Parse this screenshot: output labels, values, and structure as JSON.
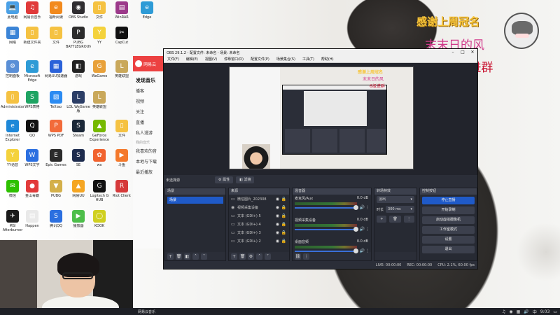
{
  "desktop": {
    "icons": [
      {
        "label": "此电脑",
        "color": "#4aa0e6",
        "glyph": "💻",
        "name": "this-pc-icon"
      },
      {
        "label": "网易云音乐",
        "color": "#e03a3a",
        "glyph": "♫",
        "name": "netease-music-icon"
      },
      {
        "label": "福昕阅读",
        "color": "#f28a1d",
        "glyph": "e",
        "name": "reader-icon"
      },
      {
        "label": "OBS Studio",
        "color": "#302e31",
        "glyph": "◉",
        "name": "obs-studio-icon"
      },
      {
        "label": "文件",
        "color": "#f5c242",
        "glyph": "▯",
        "name": "folder-icon"
      },
      {
        "label": "WinRAR",
        "color": "#9c3a8a",
        "glyph": "▤",
        "name": "winrar-icon"
      },
      {
        "label": "Edge",
        "color": "#2e9bd6",
        "glyph": "e",
        "name": "edge-browser-icon"
      },
      {
        "label": "网络",
        "color": "#3b84d6",
        "glyph": "▦",
        "name": "network-icon"
      },
      {
        "label": "新建文件夹",
        "color": "#f5c242",
        "glyph": "▯",
        "name": "folder-icon"
      },
      {
        "label": "文件",
        "color": "#f5c242",
        "glyph": "▯",
        "name": "folder-icon"
      },
      {
        "label": "PUBG BATTLEGROUNDS",
        "color": "#2c2c2c",
        "glyph": "P",
        "name": "pubg-icon"
      },
      {
        "label": "YY",
        "color": "#f4d23c",
        "glyph": "Y",
        "name": "yy-icon"
      },
      {
        "label": "CapCut",
        "color": "#111111",
        "glyph": "✂",
        "name": "capcut-icon"
      },
      {
        "label": "控制面板",
        "color": "#5a8fd6",
        "glyph": "⚙",
        "name": "control-panel-icon"
      },
      {
        "label": "Microsoft Edge",
        "color": "#2e9bd6",
        "glyph": "e",
        "name": "edge-icon"
      },
      {
        "label": "网易UU加速器",
        "color": "#2b62d9",
        "glyph": "▦",
        "name": "uu-booster-icon"
      },
      {
        "label": "游戏",
        "color": "#222222",
        "glyph": "◧",
        "name": "game-icon"
      },
      {
        "label": "WeGame",
        "color": "#e8a13a",
        "glyph": "G",
        "name": "wegame-icon"
      },
      {
        "label": "英雄联盟",
        "color": "#c9a85a",
        "glyph": "L",
        "name": "league-icon"
      },
      {
        "label": "Administrator",
        "color": "#f5c242",
        "glyph": "▯",
        "name": "user-folder-icon"
      },
      {
        "label": "WPS表格",
        "color": "#1fa463",
        "glyph": "S",
        "name": "wps-sheet-icon"
      },
      {
        "label": "TeXiao",
        "color": "#2b8bf2",
        "glyph": "▧",
        "name": "texiao-icon"
      },
      {
        "label": "LOL WeGame版",
        "color": "#2c3e66",
        "glyph": "L",
        "name": "lol-wegame-icon"
      },
      {
        "label": "英雄联盟",
        "color": "#c9a85a",
        "glyph": "L",
        "name": "lol-icon"
      },
      {
        "label": "Internet Explorer",
        "color": "#1e88d8",
        "glyph": "e",
        "name": "ie-icon"
      },
      {
        "label": "QQ",
        "color": "#111111",
        "glyph": "Q",
        "name": "qq-icon"
      },
      {
        "label": "WPS PDF",
        "color": "#f26b3a",
        "glyph": "P",
        "name": "wps-pdf-icon"
      },
      {
        "label": "Steam",
        "color": "#1b2838",
        "glyph": "S",
        "name": "steam-icon"
      },
      {
        "label": "GeForce Experience",
        "color": "#76b900",
        "glyph": "▲",
        "name": "geforce-icon"
      },
      {
        "label": "文件",
        "color": "#f5c242",
        "glyph": "▯",
        "name": "folder-icon"
      },
      {
        "label": "YY语音",
        "color": "#f4d23c",
        "glyph": "Y",
        "name": "yy-voice-icon"
      },
      {
        "label": "WPS文字",
        "color": "#2b6fe0",
        "glyph": "W",
        "name": "wps-writer-icon"
      },
      {
        "label": "Epic Games",
        "color": "#2b2b2b",
        "glyph": "E",
        "name": "epic-icon"
      },
      {
        "label": "SE",
        "color": "#1d2b4d",
        "glyph": "S",
        "name": "se-icon"
      },
      {
        "label": "wx",
        "color": "#f1622e",
        "glyph": "✿",
        "name": "wx-icon"
      },
      {
        "label": "斗鱼",
        "color": "#f4792b",
        "glyph": "▶",
        "name": "douyu-icon"
      },
      {
        "label": "微信",
        "color": "#2dc100",
        "glyph": "✉",
        "name": "wechat-icon"
      },
      {
        "label": "金山毒霸",
        "color": "#e23b3b",
        "glyph": "●",
        "name": "antivirus-icon"
      },
      {
        "label": "PUBG",
        "color": "#d4b04a",
        "glyph": "▼",
        "name": "pubg-lite-icon"
      },
      {
        "label": "网易UU",
        "color": "#f5a623",
        "glyph": "▲",
        "name": "uu-icon"
      },
      {
        "label": "Logitech G HUB",
        "color": "#111111",
        "glyph": "G",
        "name": "logitech-icon"
      },
      {
        "label": "Riot Client",
        "color": "#d63a3a",
        "glyph": "R",
        "name": "riot-icon"
      },
      {
        "label": "MSI Afterburner",
        "color": "#1a1a1a",
        "glyph": "✈",
        "name": "afterburner-icon"
      },
      {
        "label": "Happen",
        "color": "#e9e9e9",
        "glyph": "▤",
        "name": "document-icon"
      },
      {
        "label": "腾讯QQ",
        "color": "#2b6fe0",
        "glyph": "S",
        "name": "tencent-icon"
      },
      {
        "label": "播放器",
        "color": "#4dbe4a",
        "glyph": "▶",
        "name": "player-icon"
      },
      {
        "label": "KOOK",
        "color": "#d0d020",
        "glyph": "◯",
        "name": "kook-icon"
      }
    ]
  },
  "overlay": {
    "title": "感谢上周冠名",
    "name": "末末日的风",
    "group": "6级进群"
  },
  "music_window": {
    "app_name": "网易云",
    "nav": [
      "发现音乐",
      "播客",
      "视频",
      "关注",
      "直播",
      "私人漫游"
    ],
    "section": "我的音乐",
    "sub": [
      "我喜欢的音",
      "本地与下载",
      "最近播放"
    ]
  },
  "obs": {
    "title": "OBS 29.1.2 - 配置文件: 未命名 - 场景: 未命名",
    "menu": [
      "文件(F)",
      "编辑(E)",
      "视图(V)",
      "停靠窗口(D)",
      "配置文件(P)",
      "场景集合(S)",
      "工具(T)",
      "帮助(H)"
    ],
    "source_bar": {
      "label": "未选择源",
      "settings": "属性",
      "filters": "滤镜"
    },
    "docks": {
      "scenes": "场景",
      "sources": "来源",
      "mixer": "混音器",
      "transitions": "转场特效",
      "controls": "控制按钮"
    },
    "scene_items": [
      "场景"
    ],
    "source_items": [
      {
        "label": "微信图片_202308",
        "icon": "▭"
      },
      {
        "label": "视频采集设备",
        "icon": "◉"
      },
      {
        "label": "文本 (GDI+) 5",
        "icon": "▭"
      },
      {
        "label": "文本 (GDI+) 4",
        "icon": "▭"
      },
      {
        "label": "文本 (GDI+) 3",
        "icon": "▭"
      },
      {
        "label": "文本 (GDI+) 2",
        "icon": "▭"
      }
    ],
    "mixer_channels": [
      {
        "label": "麦克风/Aux",
        "db": "0.0 dB"
      },
      {
        "label": "视频采集设备",
        "db": "0.0 dB"
      },
      {
        "label": "桌面音频",
        "db": "0.0 dB"
      }
    ],
    "transitions": {
      "type": "淡出",
      "duration_label": "时长",
      "duration": "300 ms"
    },
    "controls": [
      "停止直播",
      "开始录制",
      "启动虚拟摄像机",
      "工作室模式",
      "设置",
      "退出"
    ],
    "status": {
      "live": "LIVE: 00:00:00",
      "rec": "REC: 00:00:00",
      "cpu": "CPU: 2.1%, 60.00 fps"
    }
  },
  "taskbar": {
    "app": "网易云音乐",
    "time": "9:03"
  }
}
